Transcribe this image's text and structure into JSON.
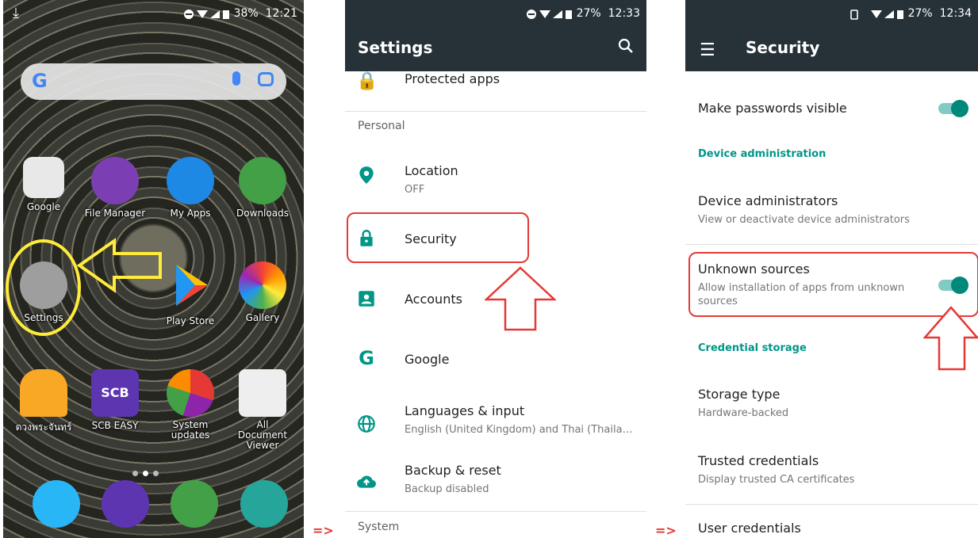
{
  "home": {
    "status": {
      "battery": "38%",
      "time": "12:21"
    },
    "apps_row1": [
      {
        "name": "Google",
        "color": "#e8e8e8"
      },
      {
        "name": "File Manager",
        "color": "#7b3fb3"
      },
      {
        "name": "My Apps",
        "color": "#1e88e5"
      },
      {
        "name": "Downloads",
        "color": "#43a047"
      }
    ],
    "apps_row2": [
      {
        "name": "Settings",
        "color": "#9e9e9e"
      },
      {
        "name": "",
        "color": "transparent"
      },
      {
        "name": "Play Store",
        "color": "transparent"
      },
      {
        "name": "Gallery",
        "color": "#fbc02d"
      }
    ],
    "apps_row3": [
      {
        "name": "ดวงพระจันทร์",
        "color": "#f9a825"
      },
      {
        "name": "SCB EASY",
        "color": "#5e35b1"
      },
      {
        "name": "System updates",
        "color": "#e53935"
      },
      {
        "name": "All Document Viewer",
        "color": "#eeeeee"
      }
    ],
    "dock_icons": [
      "message-icon",
      "email-icon",
      "phone-icon",
      "camera-icon"
    ],
    "dock_colors": [
      "#29b6f6",
      "#5e35b1",
      "#43a047",
      "#26a69a"
    ],
    "scb_label": "SCB"
  },
  "settings": {
    "status": {
      "battery": "27%",
      "time": "12:33"
    },
    "title": "Settings",
    "items": [
      {
        "label": "Protected apps",
        "icon": "lock-circle-icon"
      },
      {
        "label": "Location",
        "sub": "OFF",
        "icon": "location-icon"
      },
      {
        "label": "Security",
        "icon": "lock-icon"
      },
      {
        "label": "Accounts",
        "icon": "account-icon"
      },
      {
        "label": "Google",
        "icon": "google-icon"
      },
      {
        "label": "Languages & input",
        "sub": "English (United Kingdom) and Thai (Thaila…",
        "icon": "globe-icon"
      },
      {
        "label": "Backup & reset",
        "sub": "Backup disabled",
        "icon": "cloud-upload-icon"
      }
    ],
    "section_personal": "Personal",
    "section_system": "System"
  },
  "security": {
    "status": {
      "battery": "27%",
      "time": "12:34"
    },
    "title": "Security",
    "make_passwords": "Make passwords visible",
    "device_admin_header": "Device administration",
    "device_admins": {
      "label": "Device administrators",
      "sub": "View or deactivate device administrators"
    },
    "unknown_sources": {
      "label": "Unknown sources",
      "sub1": "Allow installation of apps from unknown",
      "sub2": "sources"
    },
    "credential_header": "Credential storage",
    "storage_type": {
      "label": "Storage type",
      "sub": "Hardware-backed"
    },
    "trusted": {
      "label": "Trusted credentials",
      "sub": "Display trusted CA certificates"
    },
    "user_credentials": "User credentials"
  },
  "arrows": {
    "first": "=>",
    "second": "=>"
  },
  "accent": "#009688",
  "highlight_red": "#e53935",
  "highlight_yellow": "#ffeb3b"
}
